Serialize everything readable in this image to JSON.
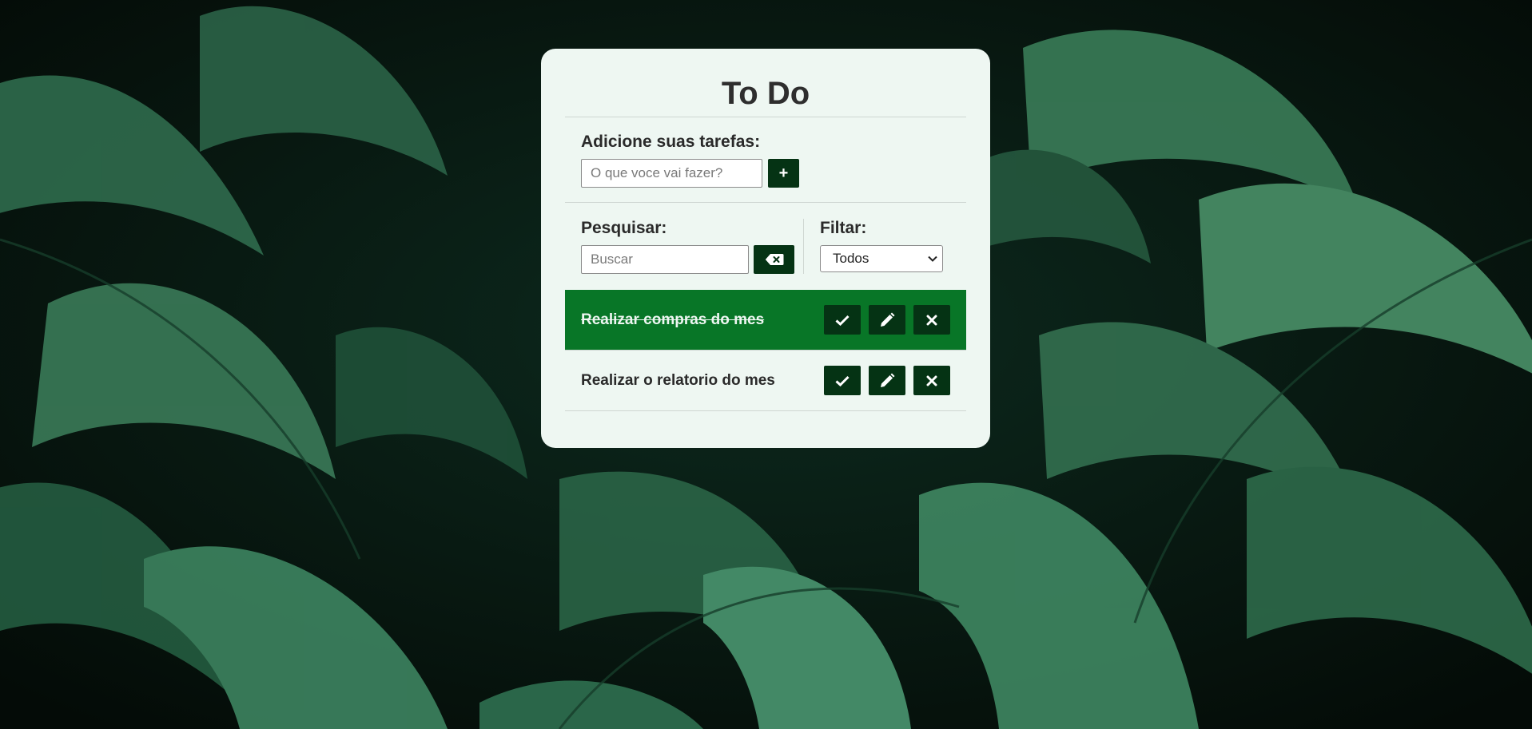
{
  "app": {
    "title": "To Do"
  },
  "add_section": {
    "label": "Adicione suas tarefas:",
    "input_placeholder": "O que voce vai fazer?",
    "input_value": "",
    "add_button_label": "+"
  },
  "search_section": {
    "label": "Pesquisar:",
    "input_placeholder": "Buscar",
    "input_value": "",
    "clear_icon": "backspace-icon"
  },
  "filter_section": {
    "label": "Filtar:",
    "selected": "Todos",
    "dropdown_icon": "chevron-down-icon"
  },
  "todos": [
    {
      "text": "Realizar compras do mes",
      "done": true
    },
    {
      "text": "Realizar o relatorio do mes",
      "done": false
    }
  ],
  "actions": {
    "finish_icon": "check-icon",
    "edit_icon": "pencil-icon",
    "remove_icon": "close-icon"
  },
  "colors": {
    "card_background": "#eef7f2",
    "button_dark": "#053314",
    "done_row": "#087627",
    "text": "#2a2a2a"
  }
}
